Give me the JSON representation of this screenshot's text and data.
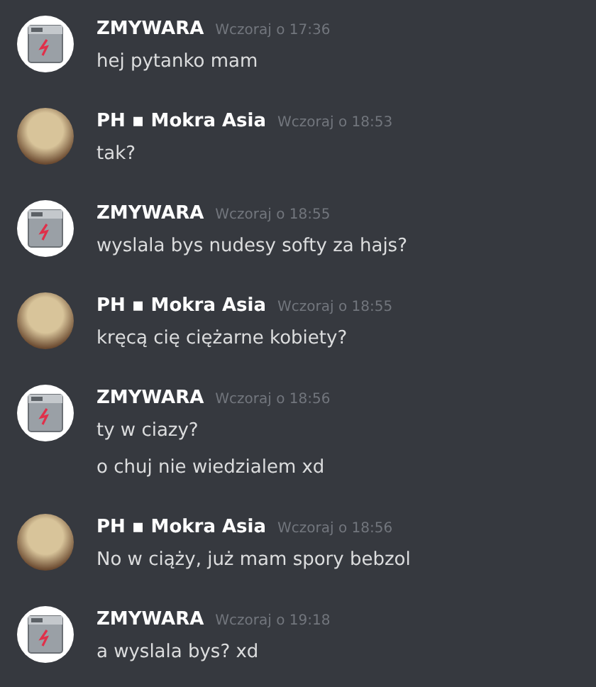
{
  "messages": [
    {
      "author": "ZMYWARA",
      "avatar": {
        "kind": "dishwasher"
      },
      "time": "Wczoraj o 17:36",
      "lines": [
        "hej pytanko mam"
      ]
    },
    {
      "author": "PH ▪ Mokra Asia",
      "avatar": {
        "kind": "photo"
      },
      "time": "Wczoraj o 18:53",
      "lines": [
        "tak?"
      ]
    },
    {
      "author": "ZMYWARA",
      "avatar": {
        "kind": "dishwasher"
      },
      "time": "Wczoraj o 18:55",
      "lines": [
        "wyslala bys nudesy softy za hajs?"
      ]
    },
    {
      "author": "PH ▪ Mokra Asia",
      "avatar": {
        "kind": "photo"
      },
      "time": "Wczoraj o 18:55",
      "lines": [
        "kręcą cię ciężarne kobiety?"
      ]
    },
    {
      "author": "ZMYWARA",
      "avatar": {
        "kind": "dishwasher"
      },
      "time": "Wczoraj o 18:56",
      "lines": [
        "ty w ciazy?",
        "o chuj nie wiedzialem xd"
      ]
    },
    {
      "author": "PH ▪ Mokra Asia",
      "avatar": {
        "kind": "photo"
      },
      "time": "Wczoraj o 18:56",
      "lines": [
        "No w ciąży, już mam spory bebzol"
      ]
    },
    {
      "author": "ZMYWARA",
      "avatar": {
        "kind": "dishwasher"
      },
      "time": "Wczoraj o 19:18",
      "lines": [
        "a wyslala bys? xd"
      ]
    }
  ]
}
